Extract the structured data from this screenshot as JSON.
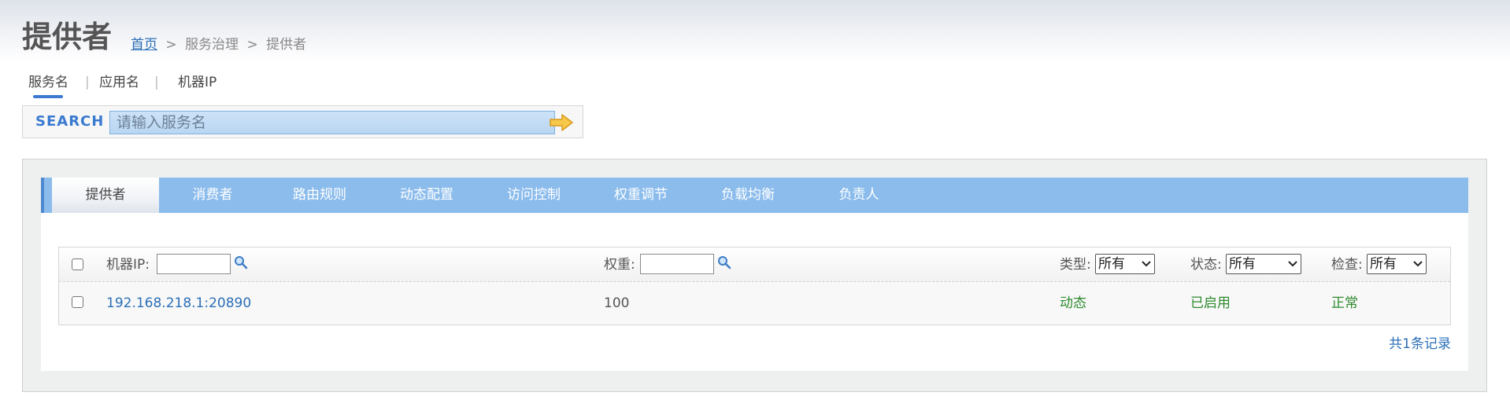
{
  "header": {
    "title": "提供者",
    "breadcrumb": {
      "home": "首页",
      "separator": ">",
      "section": "服务治理",
      "current": "提供者"
    }
  },
  "search": {
    "tabs": [
      {
        "label": "服务名",
        "active": true
      },
      {
        "label": "应用名",
        "active": false
      },
      {
        "label": "机器IP",
        "active": false
      }
    ],
    "divider": "|",
    "label": "SEARCH",
    "placeholder": "请输入服务名",
    "value": ""
  },
  "main_tabs": [
    {
      "label": "提供者",
      "active": true
    },
    {
      "label": "消费者",
      "active": false
    },
    {
      "label": "路由规则",
      "active": false
    },
    {
      "label": "动态配置",
      "active": false
    },
    {
      "label": "访问控制",
      "active": false
    },
    {
      "label": "权重调节",
      "active": false
    },
    {
      "label": "负载均衡",
      "active": false
    },
    {
      "label": "负责人",
      "active": false
    }
  ],
  "table": {
    "columns": {
      "ip": "机器IP:",
      "weight": "权重:",
      "type": "类型:",
      "status": "状态:",
      "check": "检查:"
    },
    "filters": {
      "ip_value": "",
      "weight_value": "",
      "type_selected": "所有",
      "status_selected": "所有",
      "check_selected": "所有"
    },
    "rows": [
      {
        "ip": "192.168.218.1:20890",
        "weight": "100",
        "type": "动态",
        "status": "已启用",
        "check": "正常"
      }
    ]
  },
  "footer": {
    "record_count": "共1条记录"
  },
  "colors": {
    "tab_bar": "#8bbcec",
    "link": "#2b6fb6",
    "status_green": "#2d8a2d",
    "search_label": "#3a7ad0"
  }
}
